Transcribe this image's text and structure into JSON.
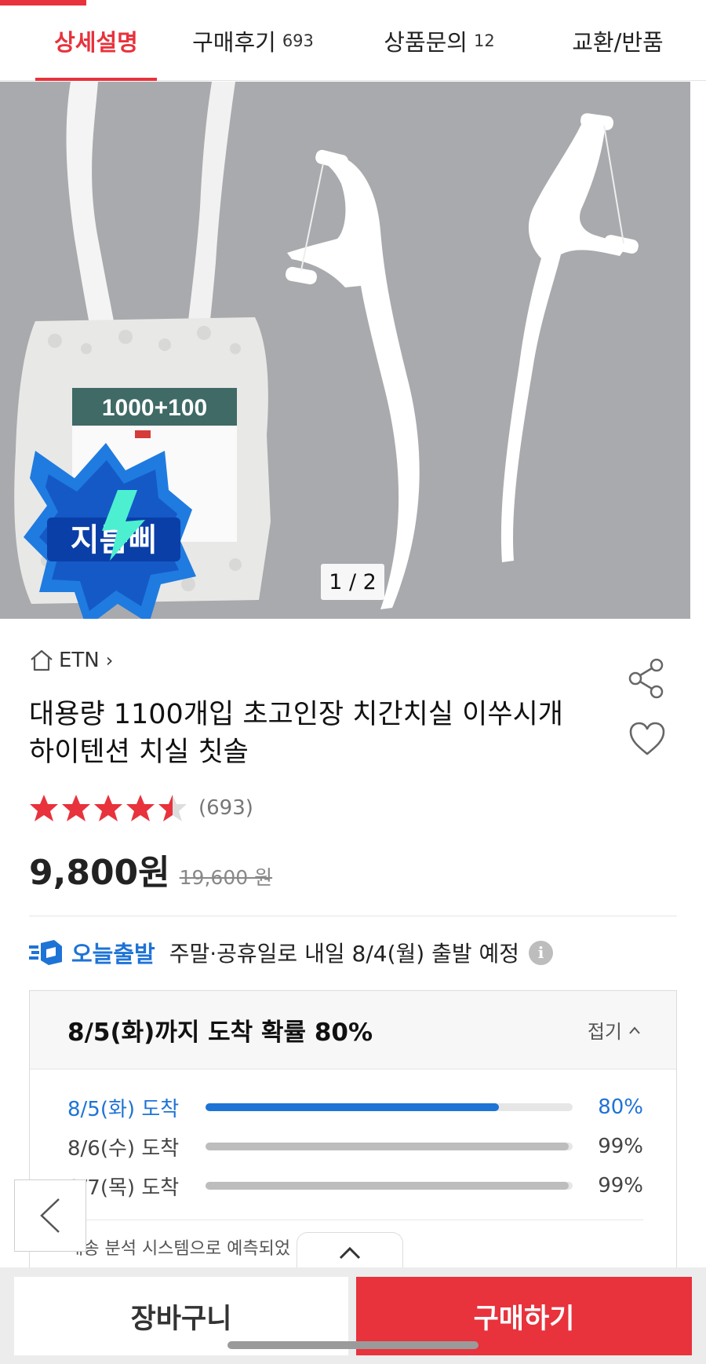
{
  "tabs": [
    {
      "label": "상세설명",
      "count": ""
    },
    {
      "label": "구매후기",
      "count": "693"
    },
    {
      "label": "상품문의",
      "count": "12"
    },
    {
      "label": "교환/반품",
      "count": ""
    }
  ],
  "gallery": {
    "page_indicator": "1 / 2",
    "package_text": "1000+100",
    "badge_text": "지름삐"
  },
  "product": {
    "brand": "ETN",
    "title_line1": "대용량 1100개입 초고인장 치간치실 이쑤시개",
    "title_line2": "하이텐션 치실 칫솔",
    "rating": 4.5,
    "rating_max": 5,
    "review_count": "(693)",
    "price": "9,800원",
    "original_price": "19,600 원"
  },
  "shipping": {
    "label": "오늘출발",
    "text": "주말·공휴일로 내일 8/4(월) 출발 예정",
    "info_icon": "i",
    "card_title": "8/5(화)까지 도착 확률 80%",
    "fold_label": "접기",
    "rows": [
      {
        "date": "8/5(화) 도착",
        "percent": 80,
        "label": "80%"
      },
      {
        "date": "8/6(수) 도착",
        "percent": 99,
        "label": "99%"
      },
      {
        "date": "8/7(목) 도착",
        "percent": 99,
        "label": "99%"
      }
    ],
    "note": "배송 분석 시스템으로 예측되었"
  },
  "actions": {
    "cart": "장바구니",
    "buy": "구매하기"
  },
  "colors": {
    "accent_red": "#e8323c",
    "ship_blue": "#1e73d6"
  }
}
